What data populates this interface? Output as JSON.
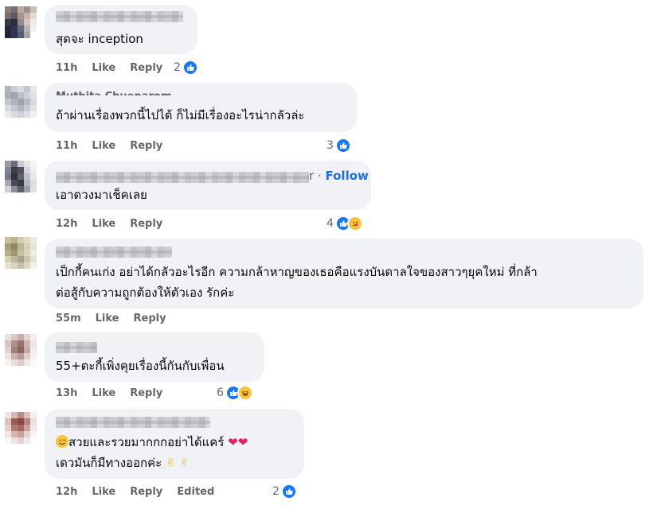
{
  "comments": [
    {
      "text": "สุดจะ inception",
      "time": "11h",
      "like": "Like",
      "reply": "Reply",
      "count": "2"
    },
    {
      "name": "Muthita Chuenarom",
      "text": "ถ้าผ่านเรื่องพวกนี้ไปได้ ก็ไม่มีเรื่องอะไรน่ากลัวล่ะ",
      "time": "11h",
      "like": "Like",
      "reply": "Reply",
      "count": "3"
    },
    {
      "name_suffix": "r",
      "follow": "Follow",
      "text": "เอาดวงมาเช็คเลย",
      "time": "12h",
      "like": "Like",
      "reply": "Reply",
      "count": "4"
    },
    {
      "text_line1": "เป็กกี้คนเก่ง อย่าได้กลัวอะไรอีก ความกล้าหาญของเธอคือแรงบันดาลใจของสาวๆยุคใหม่ ที่กล้า",
      "text_line2": "ต่อสู้กับความถูกต้องให้ตัวเอง รักค่ะ",
      "time": "55m",
      "like": "Like",
      "reply": "Reply"
    },
    {
      "text": "55+ตะกี้เพิ่งคุยเรื่องนี้กันกับเพื่อน",
      "time": "13h",
      "like": "Like",
      "reply": "Reply",
      "count": "6"
    },
    {
      "text_line1": "สวยและรวยมากกกอย่าได้แคร์",
      "text_line2": "เดวมันก็มีทางออกค่ะ",
      "time": "12h",
      "like": "Like",
      "reply": "Reply",
      "edited": "Edited",
      "count": "2"
    }
  ],
  "icons": {
    "like": "thumbs-up-icon",
    "care": "care-emoji-icon",
    "haha": "haha-emoji-icon",
    "smile": "smiling-emoji-icon",
    "heart": "heart-icon",
    "victory": "victory-hand-icon"
  },
  "colors": {
    "accent": "#1877f2",
    "bubble": "#f0f2f5",
    "meta": "#65676b",
    "follow": "#216fdb"
  }
}
